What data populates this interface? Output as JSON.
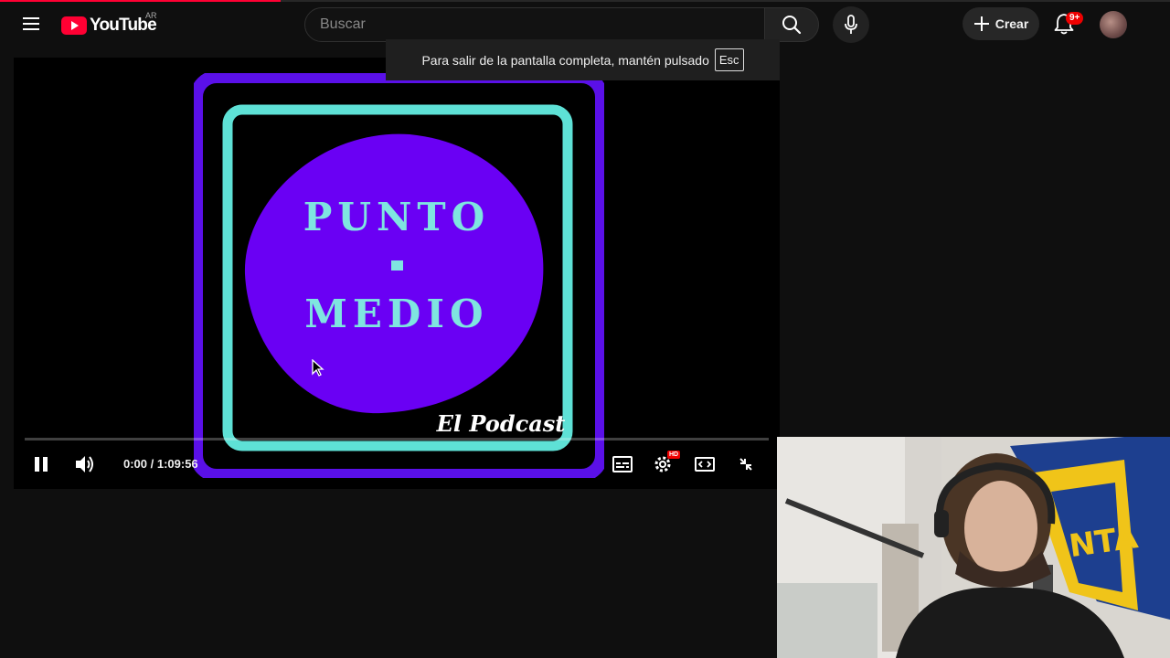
{
  "header": {
    "logo_word": "YouTube",
    "country_code": "AR",
    "search_placeholder": "Buscar",
    "create_label": "Crear",
    "notification_count": "9+",
    "load_progress_fraction": 0.24
  },
  "toast": {
    "message": "Para salir de la pantalla completa, mantén pulsado",
    "key": "Esc"
  },
  "video": {
    "artwork_title_line1": "PUNTO",
    "artwork_title_line2": "MEDIO",
    "artwork_subtitle": "El Podcast",
    "time_display": "0:00 / 1:09:56",
    "progress_fraction": 0.0,
    "settings_badge": "HD"
  },
  "colors": {
    "accent_red": "#ff0033",
    "art_purple": "#6a00f4",
    "art_frame_purple": "#5a10e8",
    "art_cyan": "#5ee1d6",
    "background": "#0f0f0f"
  },
  "icons": {
    "menu": "menu-icon",
    "search": "search-icon",
    "mic": "mic-icon",
    "create": "plus-icon",
    "notifications": "bell-icon",
    "play_pause": "pause-icon",
    "volume": "volume-icon",
    "subtitles": "subtitles-icon",
    "settings": "gear-icon",
    "theater": "theater-mode-icon",
    "fullscreen": "exit-fullscreen-icon"
  }
}
